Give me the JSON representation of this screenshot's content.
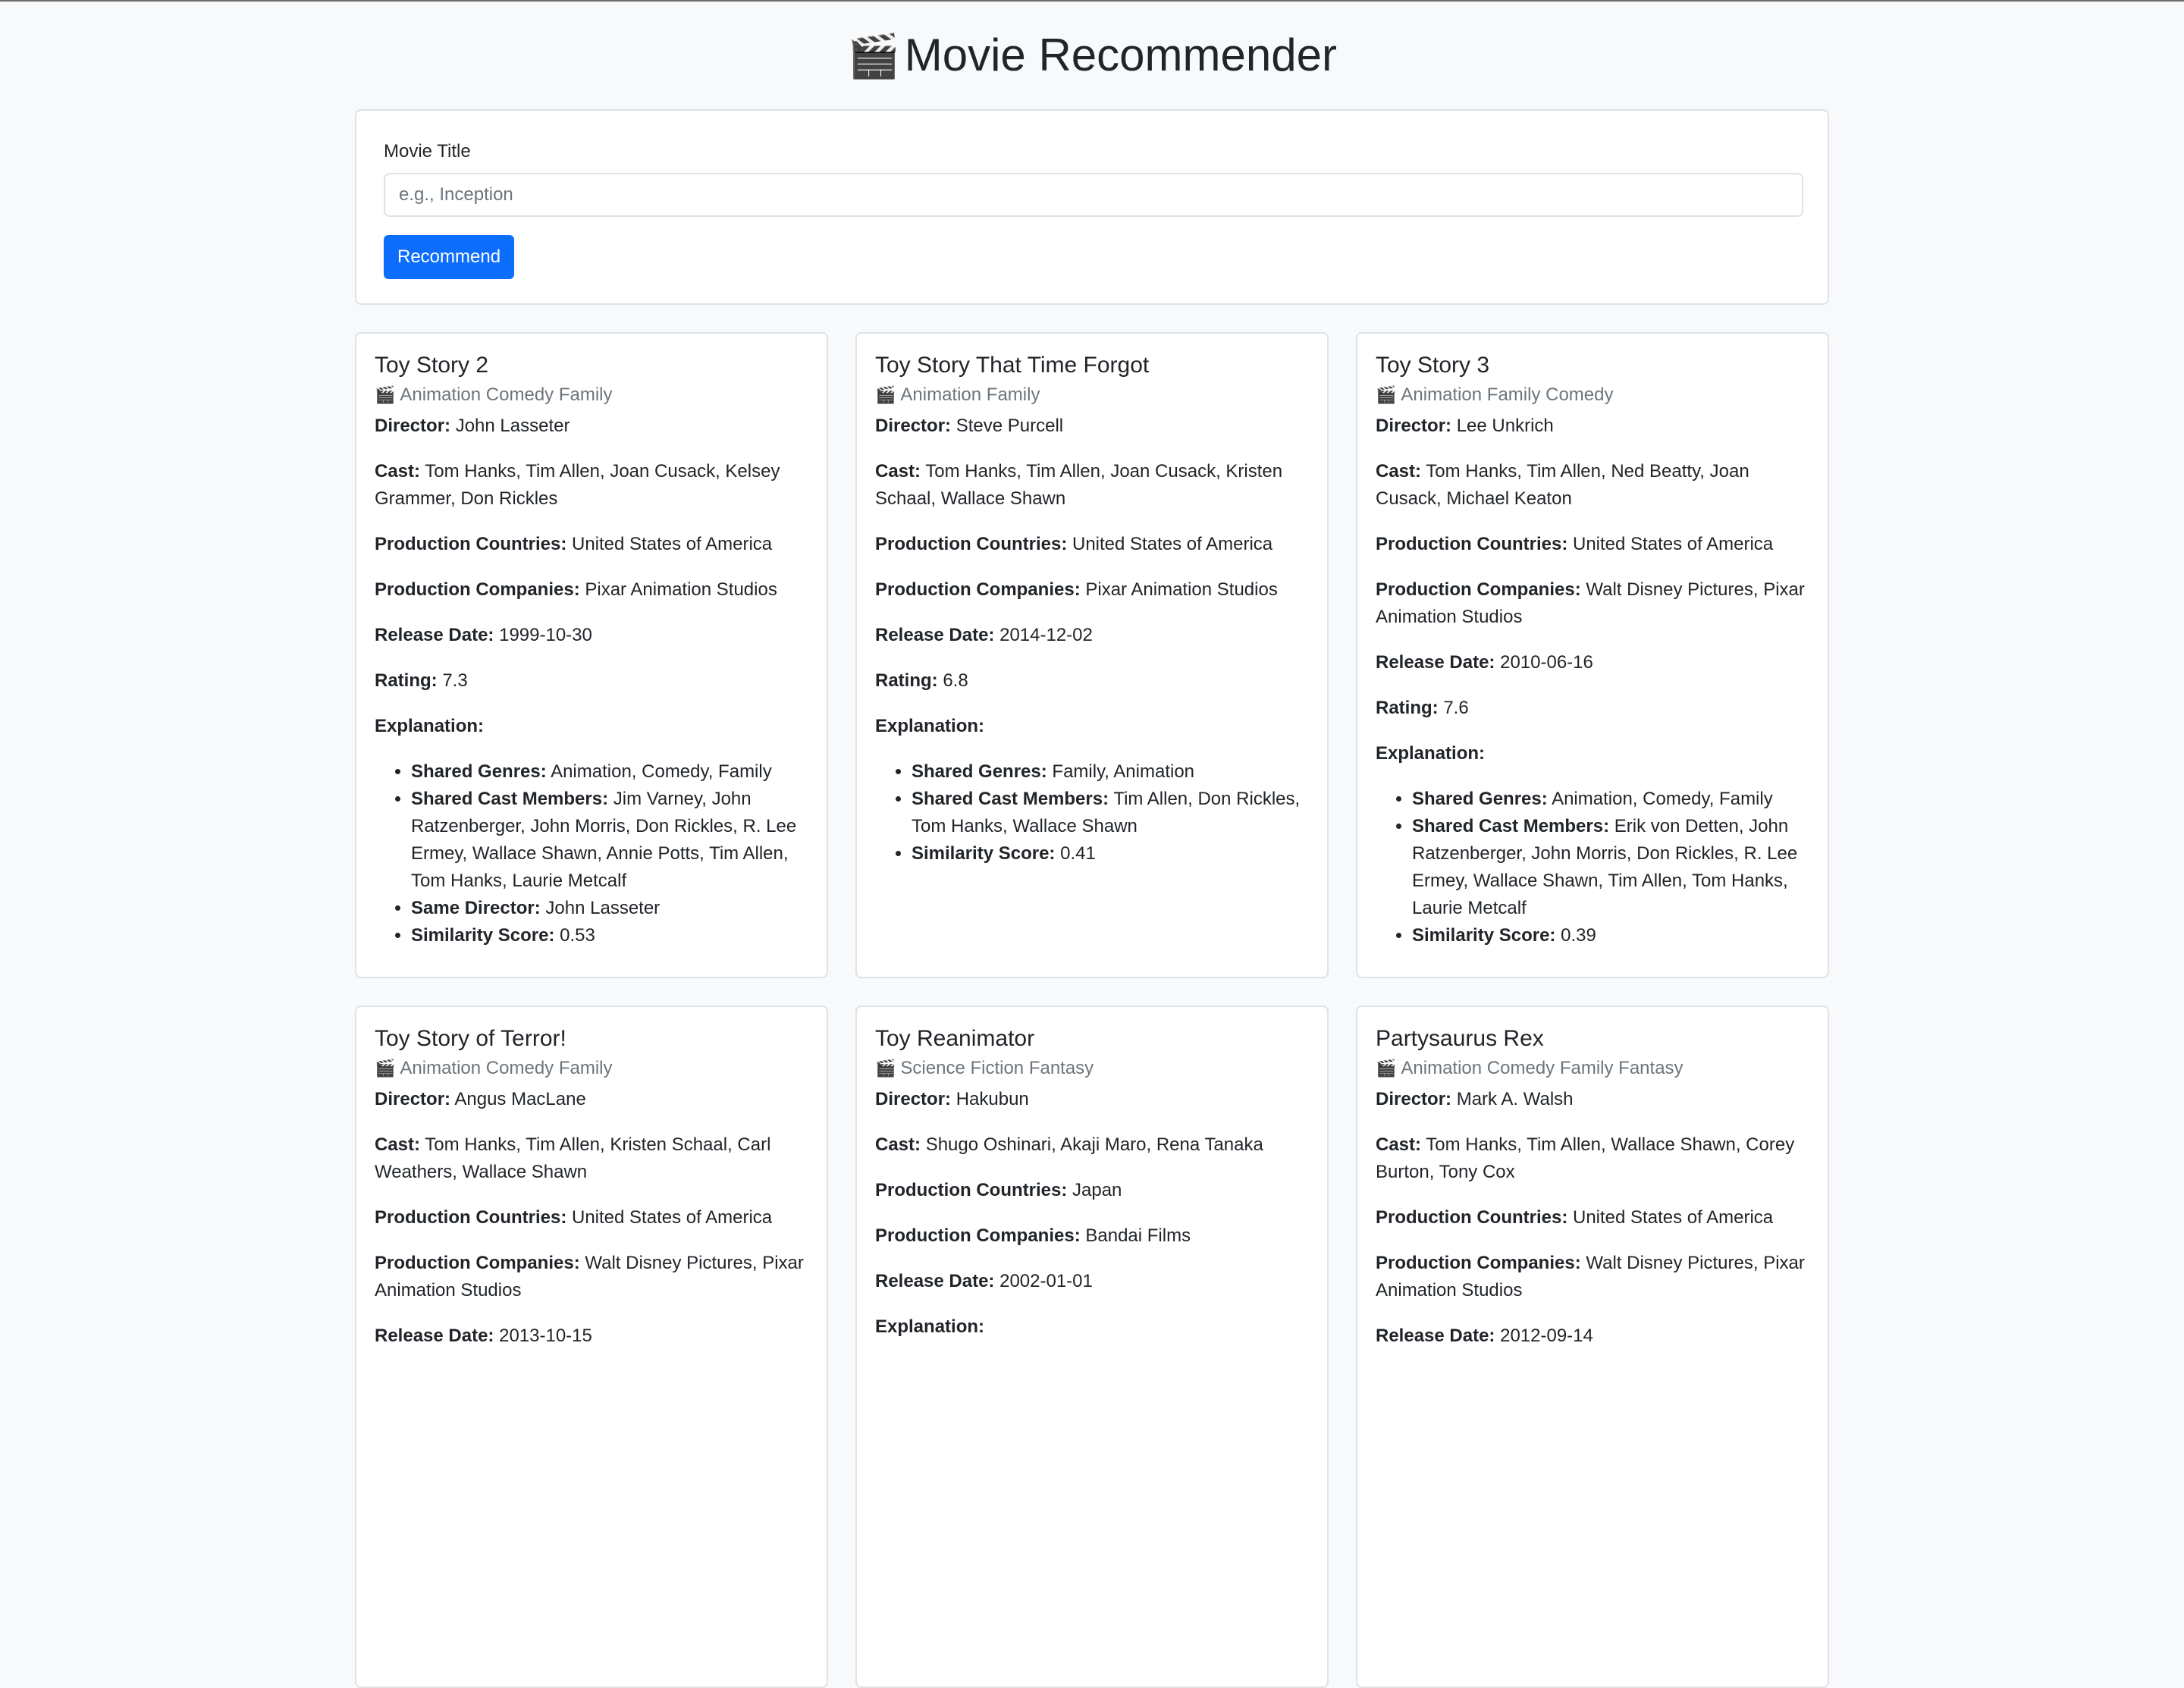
{
  "header": {
    "icon": "🎬",
    "title": "Movie Recommender"
  },
  "search": {
    "label": "Movie Title",
    "placeholder": "e.g., Inception",
    "value": "",
    "button_label": "Recommend"
  },
  "labels": {
    "director": "Director:",
    "cast": "Cast:",
    "countries": "Production Countries:",
    "companies": "Production Companies:",
    "release": "Release Date:",
    "rating": "Rating:",
    "explanation": "Explanation:",
    "shared_genres": "Shared Genres:",
    "shared_cast": "Shared Cast Members:",
    "same_director": "Same Director:",
    "similarity": "Similarity Score:"
  },
  "genre_icon": "🎬",
  "movies": [
    {
      "title": "Toy Story 2",
      "genres": "Animation Comedy Family",
      "director": "John Lasseter",
      "cast": "Tom Hanks, Tim Allen, Joan Cusack, Kelsey Grammer, Don Rickles",
      "countries": "United States of America",
      "companies": "Pixar Animation Studios",
      "release": "1999-10-30",
      "rating": "7.3",
      "shared_genres": "Animation, Comedy, Family",
      "shared_cast": "Jim Varney, John Ratzenberger, John Morris, Don Rickles, R. Lee Ermey, Wallace Shawn, Annie Potts, Tim Allen, Tom Hanks, Laurie Metcalf",
      "same_director": "John Lasseter",
      "similarity": "0.53"
    },
    {
      "title": "Toy Story That Time Forgot",
      "genres": "Animation Family",
      "director": "Steve Purcell",
      "cast": "Tom Hanks, Tim Allen, Joan Cusack, Kristen Schaal, Wallace Shawn",
      "countries": "United States of America",
      "companies": "Pixar Animation Studios",
      "release": "2014-12-02",
      "rating": "6.8",
      "shared_genres": "Family, Animation",
      "shared_cast": "Tim Allen, Don Rickles, Tom Hanks, Wallace Shawn",
      "similarity": "0.41"
    },
    {
      "title": "Toy Story 3",
      "genres": "Animation Family Comedy",
      "director": "Lee Unkrich",
      "cast": "Tom Hanks, Tim Allen, Ned Beatty, Joan Cusack, Michael Keaton",
      "countries": "United States of America",
      "companies": "Walt Disney Pictures, Pixar Animation Studios",
      "release": "2010-06-16",
      "rating": "7.6",
      "shared_genres": "Animation, Comedy, Family",
      "shared_cast": "Erik von Detten, John Ratzenberger, John Morris, Don Rickles, R. Lee Ermey, Wallace Shawn, Tim Allen, Tom Hanks, Laurie Metcalf",
      "similarity": "0.39"
    },
    {
      "title": "Toy Story of Terror!",
      "genres": "Animation Comedy Family",
      "director": "Angus MacLane",
      "cast": "Tom Hanks, Tim Allen, Kristen Schaal, Carl Weathers, Wallace Shawn",
      "countries": "United States of America",
      "companies": "Walt Disney Pictures, Pixar Animation Studios",
      "release": "2013-10-15"
    },
    {
      "title": "Toy Reanimator",
      "genres": "Science Fiction Fantasy",
      "director": "Hakubun",
      "cast": "Shugo Oshinari, Akaji Maro, Rena Tanaka",
      "countries": "Japan",
      "companies": "Bandai Films",
      "release": "2002-01-01"
    },
    {
      "title": "Partysaurus Rex",
      "genres": "Animation Comedy Family Fantasy",
      "director": "Mark A. Walsh",
      "cast": "Tom Hanks, Tim Allen, Wallace Shawn, Corey Burton, Tony Cox",
      "countries": "United States of America",
      "companies": "Walt Disney Pictures, Pixar Animation Studios",
      "release": "2012-09-14"
    }
  ]
}
